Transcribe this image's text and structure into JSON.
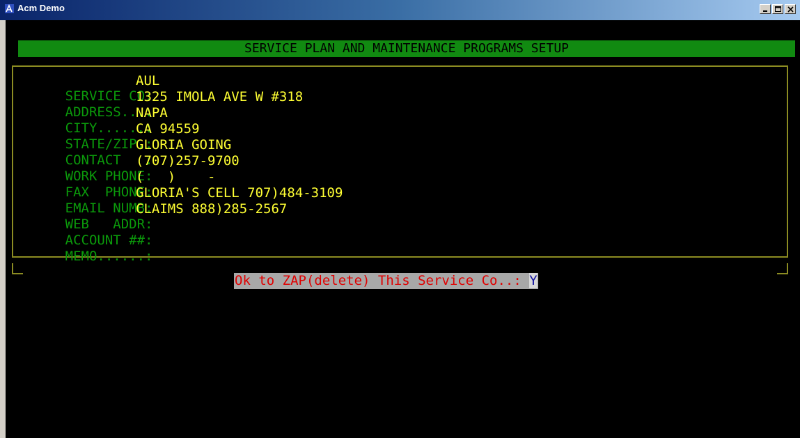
{
  "window": {
    "title": "Acm Demo",
    "app_icon": "acm-icon",
    "buttons": [
      "minimize-icon",
      "restore-icon",
      "close-icon"
    ]
  },
  "screen": {
    "header": "SERVICE PLAN AND MAINTENANCE PROGRAMS SETUP",
    "fields": [
      {
        "label": "SERVICE CO:",
        "value": "AUL"
      },
      {
        "label": "ADDRESS...:",
        "value": "1325 IMOLA AVE W #318"
      },
      {
        "label": "CITY......:",
        "value": "NAPA"
      },
      {
        "label": "STATE/ZIP.:",
        "value": "CA 94559"
      },
      {
        "label": "CONTACT   :",
        "value": "GLORIA GOING"
      },
      {
        "label": "WORK PHONE:",
        "value": "(707)257-9700"
      },
      {
        "label": "FAX  PHONE:",
        "value": "(   )    -"
      },
      {
        "label": "EMAIL NUMB:",
        "value": "GLORIA'S CELL 707)484-3109"
      },
      {
        "label": "WEB   ADDR:",
        "value": "CLAIMS 888)285-2567"
      },
      {
        "label": "ACCOUNT ##:",
        "value": ""
      },
      {
        "label": "MEMO......:",
        "value": ""
      }
    ],
    "prompt": "Ok to ZAP(delete) This Service Co..: ",
    "answer": "Y"
  },
  "colors": {
    "header_bg": "#118a11",
    "label": "#0b9a0b",
    "value": "#ffff33",
    "frame": "#8c8c22",
    "prompt_text": "#e00000"
  }
}
